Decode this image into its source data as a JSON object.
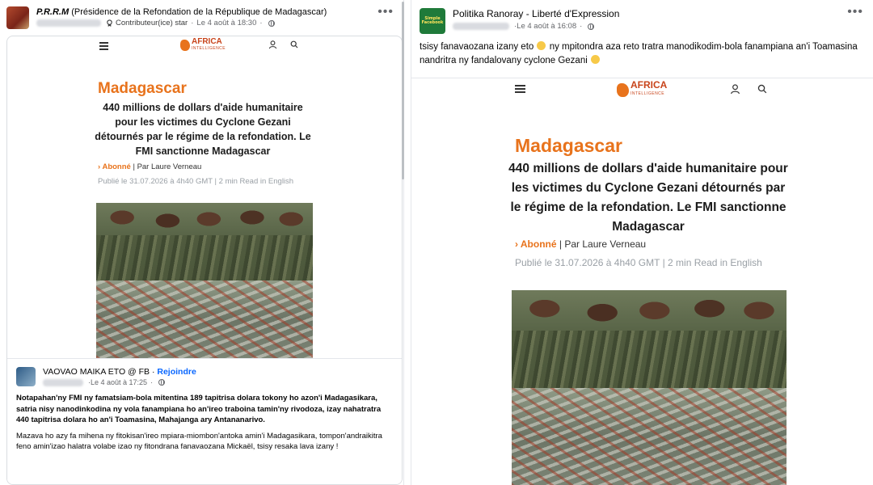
{
  "left_post": {
    "page_name_bold": "P.R.R.M",
    "page_name_rest": " (Présidence de la Refondation de la République de Madagascar)",
    "badge": "Contributeur(ice) star",
    "date": "Le 4 août à 18:30",
    "more": "•••"
  },
  "article": {
    "logo_main": "AFRICA",
    "logo_sub": "INTELLIGENCE",
    "country": "Madagascar",
    "headline": "440 millions de dollars d'aide humanitaire pour les victimes du Cyclone Gezani détournés par le régime de la refondation. Le FMI sanctionne Madagascar",
    "abonne": "Abonné",
    "author": "Par Laure Verneau",
    "published": "Publié le 31.07.2026 à 4h40 GMT",
    "readtime": "2 min Read in English"
  },
  "comment": {
    "name": "VAOVAO MAIKA ETO @ FB",
    "join": "Rejoindre",
    "date": "Le 4 août à 17:25",
    "para1": "Notapahan'ny FMI ny famatsiam-bola mitentina 189 tapitrisa dolara tokony ho azon'i Madagasikara, satria nisy nanodinkodina ny vola fanampiana ho an'ireo traboina tamin'ny rivodoza, izay nahatratra 440 tapitrisa dolara ho an'i Toamasina, Mahajanga ary Antananarivo.",
    "para2": "Mazava ho azy fa mihena ny fitokisan'ireo mpiara-miombon'antoka amin'i Madagasikara, tompon'andraikitra feno amin'izao halatra volabe izao ny fitondrana fanavaozana Mickaël, tsisy resaka lava izany !"
  },
  "right_post": {
    "page_name": "Politika Ranoray - Liberté d'Expression",
    "avatar_text": "Simple Facebook",
    "date": "Le 4 août à 16:08",
    "more": "•••",
    "caption_1": "tsisy fanavaozana izany eto",
    "caption_2": "ny mpitondra aza reto tratra manodikodim-bola fanampiana an'i Toamasina nandritra ny fandalovany cyclone Gezani"
  },
  "colors": {
    "link_blue": "#0866ff",
    "accent_orange": "#e8731c",
    "meta_gray": "#65676b"
  }
}
